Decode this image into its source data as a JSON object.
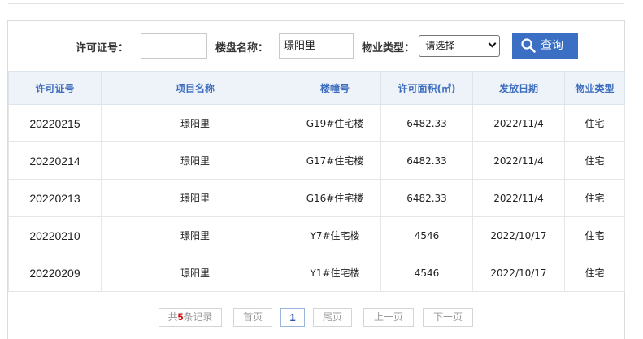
{
  "search": {
    "license_label": "许可证号：",
    "license_value": "",
    "project_label": "楼盘名称：",
    "project_value": "璟阳里",
    "type_label": "物业类型：",
    "type_selected": "-请选择-",
    "query_label": "查询"
  },
  "table": {
    "headers": [
      "许可证号",
      "项目名称",
      "楼幢号",
      "许可面积(㎡)",
      "发放日期",
      "物业类型"
    ],
    "rows": [
      [
        "20220215",
        "璟阳里",
        "G19#住宅楼",
        "6482.33",
        "2022/11/4",
        "住宅"
      ],
      [
        "20220214",
        "璟阳里",
        "G17#住宅楼",
        "6482.33",
        "2022/11/4",
        "住宅"
      ],
      [
        "20220213",
        "璟阳里",
        "G16#住宅楼",
        "6482.33",
        "2022/11/4",
        "住宅"
      ],
      [
        "20220210",
        "璟阳里",
        "Y7#住宅楼",
        "4546",
        "2022/10/17",
        "住宅"
      ],
      [
        "20220209",
        "璟阳里",
        "Y1#住宅楼",
        "4546",
        "2022/10/17",
        "住宅"
      ]
    ]
  },
  "pager": {
    "total_prefix": "共",
    "total_count": "5",
    "total_suffix": "条记录",
    "first": "首页",
    "current_page": "1",
    "last": "尾页",
    "prev": "上一页",
    "next": "下一页"
  },
  "colors": {
    "accent": "#3b6fc4",
    "header_bg": "#eef3fa",
    "header_text": "#3d6dbd"
  }
}
